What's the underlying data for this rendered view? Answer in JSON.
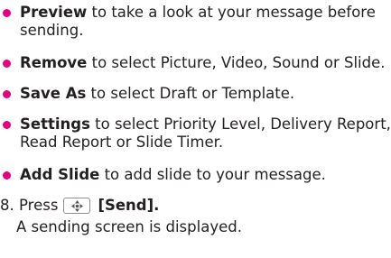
{
  "bullets": [
    {
      "term": "Preview",
      "rest": " to take a look at your message before sending."
    },
    {
      "term": "Remove",
      "rest": " to select Picture, Video, Sound or Slide."
    },
    {
      "term": "Save As",
      "rest": " to select Draft or Template."
    },
    {
      "term": "Settings",
      "rest": " to select Priority Level, Delivery Report, Read Report or Slide Timer."
    },
    {
      "term": "Add Slide",
      "rest": " to add slide to your message."
    }
  ],
  "step": {
    "number": "8.",
    "press_label": "Press",
    "key_icon": "navigation-key-icon",
    "key_label": "[Send].",
    "note": "A sending screen is displayed."
  },
  "colors": {
    "bullet": "#e4007f",
    "text": "#231f20"
  }
}
